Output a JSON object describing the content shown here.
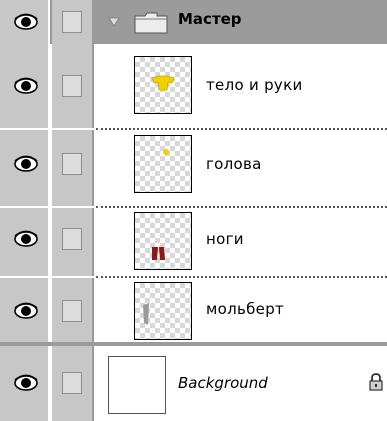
{
  "group": {
    "name": "Мастер",
    "expanded": true
  },
  "layers": [
    {
      "name": "тело и руки",
      "thumb": "yellow-shirt"
    },
    {
      "name": "голова",
      "thumb": "yellow-dot"
    },
    {
      "name": "ноги",
      "thumb": "red-legs"
    },
    {
      "name": "мольберт",
      "thumb": "gray-easel"
    }
  ],
  "background_layer": {
    "name": "Background",
    "locked": true
  },
  "colors": {
    "panel_gray": "#c7c7c7",
    "header_gray": "#9b9b9b",
    "highlight_yellow": "#f2d000",
    "legs_red": "#8b1a1a"
  }
}
